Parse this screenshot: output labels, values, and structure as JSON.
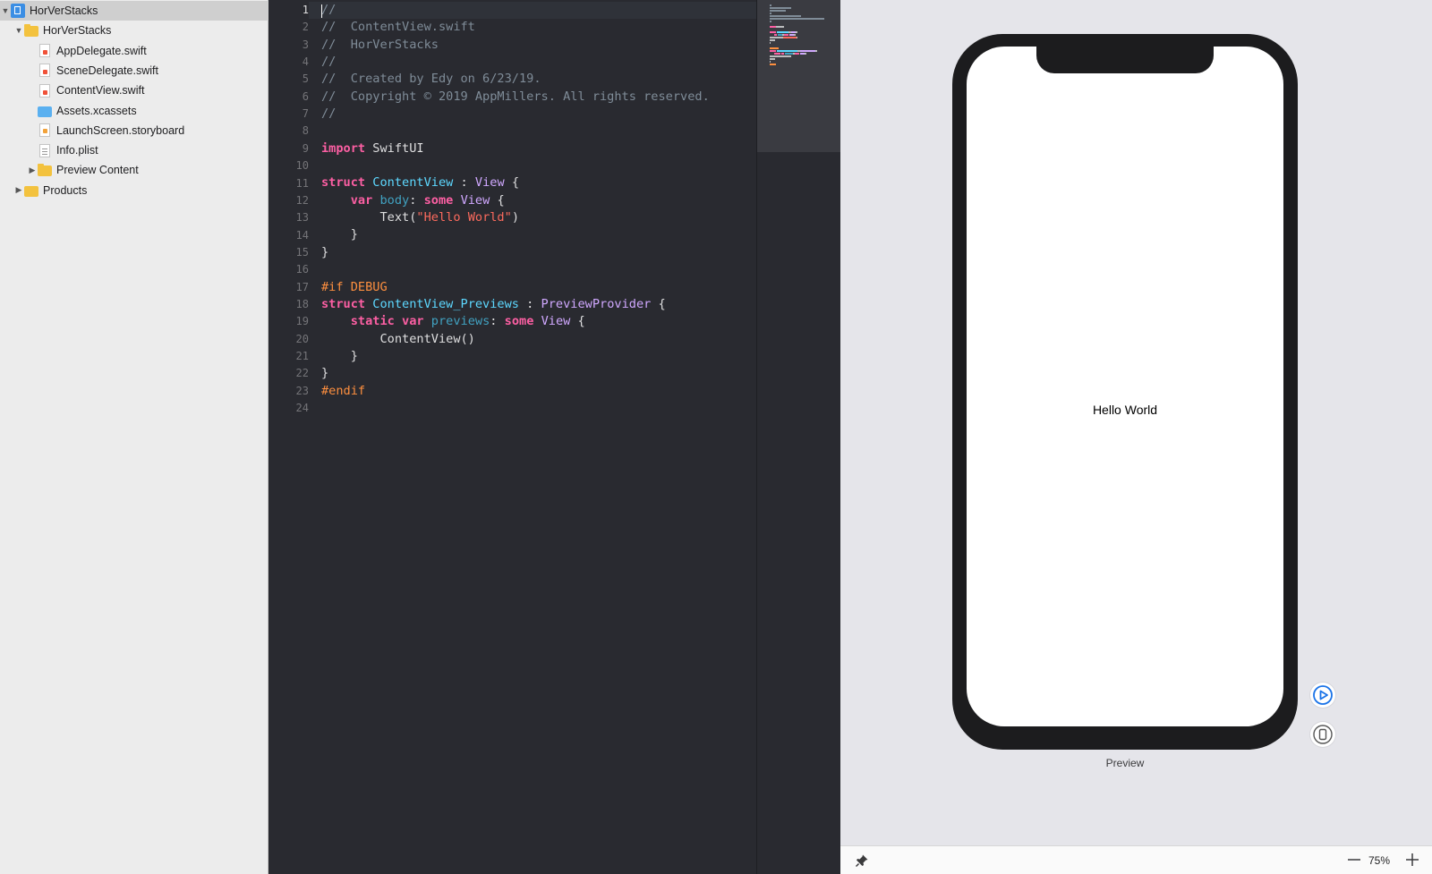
{
  "navigator": {
    "items": [
      {
        "label": "HorVerStacks",
        "icon": "project-icon",
        "disclosure": "▼",
        "indent": 0,
        "selected": true
      },
      {
        "label": "HorVerStacks",
        "icon": "folder-icon",
        "disclosure": "▼",
        "indent": 1
      },
      {
        "label": "AppDelegate.swift",
        "icon": "swift-file-icon",
        "indent": 2
      },
      {
        "label": "SceneDelegate.swift",
        "icon": "swift-file-icon",
        "indent": 2
      },
      {
        "label": "ContentView.swift",
        "icon": "swift-file-icon",
        "indent": 2
      },
      {
        "label": "Assets.xcassets",
        "icon": "assets-folder-icon",
        "indent": 2
      },
      {
        "label": "LaunchScreen.storyboard",
        "icon": "storyboard-file-icon",
        "indent": 2
      },
      {
        "label": "Info.plist",
        "icon": "plist-file-icon",
        "indent": 2
      },
      {
        "label": "Preview Content",
        "icon": "folder-icon",
        "disclosure": "▶",
        "indent": 2
      },
      {
        "label": "Products",
        "icon": "products-folder-icon",
        "disclosure": "▶",
        "indent": 1
      }
    ]
  },
  "editor": {
    "current_line": 1,
    "lines": [
      [
        {
          "t": "//",
          "c": "comment"
        }
      ],
      [
        {
          "t": "//  ContentView.swift",
          "c": "comment"
        }
      ],
      [
        {
          "t": "//  HorVerStacks",
          "c": "comment"
        }
      ],
      [
        {
          "t": "//",
          "c": "comment"
        }
      ],
      [
        {
          "t": "//  Created by Edy on 6/23/19.",
          "c": "comment"
        }
      ],
      [
        {
          "t": "//  Copyright © 2019 AppMillers. All rights reserved.",
          "c": "comment"
        }
      ],
      [
        {
          "t": "//",
          "c": "comment"
        }
      ],
      [],
      [
        {
          "t": "import",
          "c": "kw"
        },
        {
          "t": " SwiftUI",
          "c": "plain"
        }
      ],
      [],
      [
        {
          "t": "struct",
          "c": "kw"
        },
        {
          "t": " ",
          "c": "plain"
        },
        {
          "t": "ContentView",
          "c": "type"
        },
        {
          "t": " : ",
          "c": "plain"
        },
        {
          "t": "View",
          "c": "type2"
        },
        {
          "t": " {",
          "c": "plain"
        }
      ],
      [
        {
          "t": "    ",
          "c": "plain"
        },
        {
          "t": "var",
          "c": "kw"
        },
        {
          "t": " ",
          "c": "plain"
        },
        {
          "t": "body",
          "c": "prop"
        },
        {
          "t": ": ",
          "c": "plain"
        },
        {
          "t": "some",
          "c": "kw"
        },
        {
          "t": " ",
          "c": "plain"
        },
        {
          "t": "View",
          "c": "type2"
        },
        {
          "t": " {",
          "c": "plain"
        }
      ],
      [
        {
          "t": "        Text(",
          "c": "plain"
        },
        {
          "t": "\"Hello World\"",
          "c": "str"
        },
        {
          "t": ")",
          "c": "plain"
        }
      ],
      [
        {
          "t": "    }",
          "c": "plain"
        }
      ],
      [
        {
          "t": "}",
          "c": "plain"
        }
      ],
      [],
      [
        {
          "t": "#if DEBUG",
          "c": "pre"
        }
      ],
      [
        {
          "t": "struct",
          "c": "kw"
        },
        {
          "t": " ",
          "c": "plain"
        },
        {
          "t": "ContentView_Previews",
          "c": "type"
        },
        {
          "t": " : ",
          "c": "plain"
        },
        {
          "t": "PreviewProvider",
          "c": "type2"
        },
        {
          "t": " {",
          "c": "plain"
        }
      ],
      [
        {
          "t": "    ",
          "c": "plain"
        },
        {
          "t": "static",
          "c": "kw"
        },
        {
          "t": " ",
          "c": "plain"
        },
        {
          "t": "var",
          "c": "kw"
        },
        {
          "t": " ",
          "c": "plain"
        },
        {
          "t": "previews",
          "c": "prop"
        },
        {
          "t": ": ",
          "c": "plain"
        },
        {
          "t": "some",
          "c": "kw"
        },
        {
          "t": " ",
          "c": "plain"
        },
        {
          "t": "View",
          "c": "type2"
        },
        {
          "t": " {",
          "c": "plain"
        }
      ],
      [
        {
          "t": "        ContentView()",
          "c": "plain"
        }
      ],
      [
        {
          "t": "    }",
          "c": "plain"
        }
      ],
      [
        {
          "t": "}",
          "c": "plain"
        }
      ],
      [
        {
          "t": "#endif",
          "c": "pre"
        }
      ],
      []
    ]
  },
  "preview": {
    "screen_text": "Hello World",
    "label": "Preview"
  },
  "bottom_bar": {
    "zoom_level": "75%",
    "zoom_out_symbol": "—",
    "zoom_in_symbol": "+"
  },
  "colors": {
    "editor_bg": "#292a30",
    "keyword": "#fc5fa3",
    "type": "#5dd8ff",
    "string": "#fc6a5d",
    "comment": "#7f8c98",
    "preprocessor": "#fd8f3f",
    "accent_blue": "#1a73e8"
  }
}
